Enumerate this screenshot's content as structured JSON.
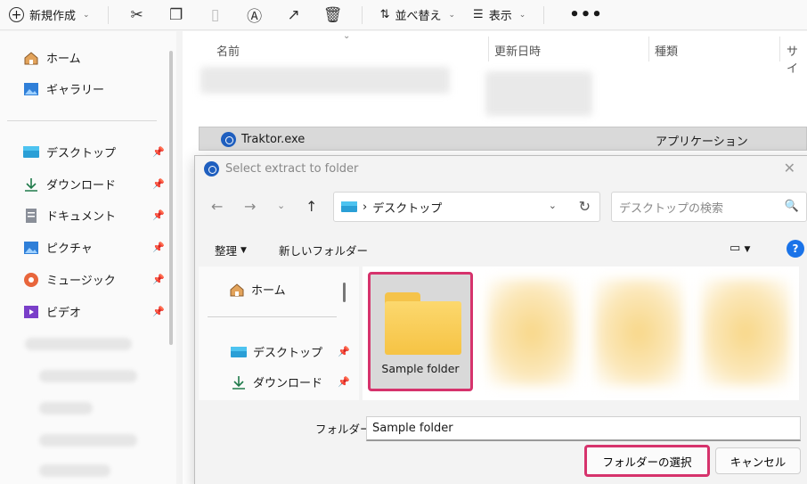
{
  "toolbar": {
    "new_label": "新規作成",
    "sort_label": "並べ替え",
    "view_label": "表示",
    "more_label": "•••"
  },
  "nav": {
    "items": [
      {
        "label": "ホーム",
        "icon": "home-icon"
      },
      {
        "label": "ギャラリー",
        "icon": "gallery-icon"
      },
      {
        "label": "デスクトップ",
        "icon": "desktop-icon"
      },
      {
        "label": "ダウンロード",
        "icon": "download-icon"
      },
      {
        "label": "ドキュメント",
        "icon": "document-icon"
      },
      {
        "label": "ピクチャ",
        "icon": "picture-icon"
      },
      {
        "label": "ミュージック",
        "icon": "music-icon"
      },
      {
        "label": "ビデオ",
        "icon": "video-icon"
      }
    ]
  },
  "list": {
    "columns": [
      "名前",
      "更新日時",
      "種類",
      "サイ"
    ],
    "selected_file": {
      "name": "Traktor.exe",
      "type": "アプリケーション"
    }
  },
  "dialog": {
    "title": "Select extract to folder",
    "address_path": "デスクトップ",
    "search_placeholder": "デスクトップの検索",
    "organize_label": "整理",
    "new_folder_label": "新しいフォルダー",
    "nav_items": [
      {
        "label": "ホーム"
      },
      {
        "label": "デスクトップ"
      },
      {
        "label": "ダウンロード"
      }
    ],
    "selected_folder": "Sample folder",
    "folder_field_label": "フォルダー:",
    "folder_field_value": "Sample folder",
    "select_button": "フォルダーの選択",
    "cancel_button": "キャンセル"
  },
  "colors": {
    "highlight": "#d6336c",
    "accent": "#1a73e8"
  }
}
